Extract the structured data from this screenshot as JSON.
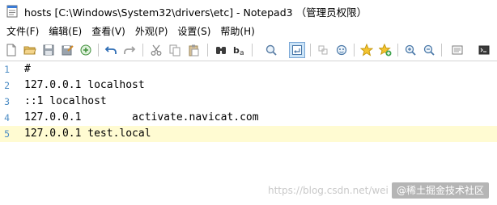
{
  "window": {
    "title": "hosts [C:\\Windows\\System32\\drivers\\etc] - Notepad3 （管理员权限）",
    "icon": "notepad-icon"
  },
  "menu": {
    "items": [
      {
        "label": "文件(F)"
      },
      {
        "label": "编辑(E)"
      },
      {
        "label": "查看(V)"
      },
      {
        "label": "外观(P)"
      },
      {
        "label": "设置(S)"
      },
      {
        "label": "帮助(H)"
      }
    ]
  },
  "toolbar": {
    "buttons": [
      {
        "icon": "new-file-icon"
      },
      {
        "icon": "open-folder-icon"
      },
      {
        "icon": "save-icon"
      },
      {
        "icon": "save-as-icon"
      },
      {
        "icon": "browse-icon"
      },
      {
        "icon": "undo-icon"
      },
      {
        "icon": "redo-icon"
      },
      {
        "icon": "cut-icon"
      },
      {
        "icon": "copy-icon"
      },
      {
        "icon": "paste-icon"
      },
      {
        "icon": "find-icon"
      },
      {
        "icon": "replace-icon"
      },
      {
        "icon": "goto-icon"
      },
      {
        "icon": "word-wrap-icon",
        "active": true
      },
      {
        "icon": "whitespace-icon"
      },
      {
        "icon": "mark-occurrences-icon"
      },
      {
        "icon": "favorites-icon"
      },
      {
        "icon": "add-favorite-icon"
      },
      {
        "icon": "zoom-in-icon"
      },
      {
        "icon": "zoom-out-icon"
      },
      {
        "icon": "scheme-icon"
      },
      {
        "icon": "settings-icon"
      }
    ]
  },
  "editor": {
    "lines": [
      {
        "number": "1",
        "text": "#"
      },
      {
        "number": "2",
        "text": "127.0.0.1 localhost"
      },
      {
        "number": "3",
        "text": "::1 localhost"
      },
      {
        "number": "4",
        "text": "127.0.0.1        activate.navicat.com"
      },
      {
        "number": "5",
        "text": "127.0.0.1 test.local"
      }
    ],
    "current_line": 5,
    "current_line_color": "#fffbd2",
    "line_number_color": "#4c8cc4"
  },
  "overlay": {
    "watermark": "https://blog.csdn.net/wei",
    "badge": "@稀土掘金技术社区"
  }
}
